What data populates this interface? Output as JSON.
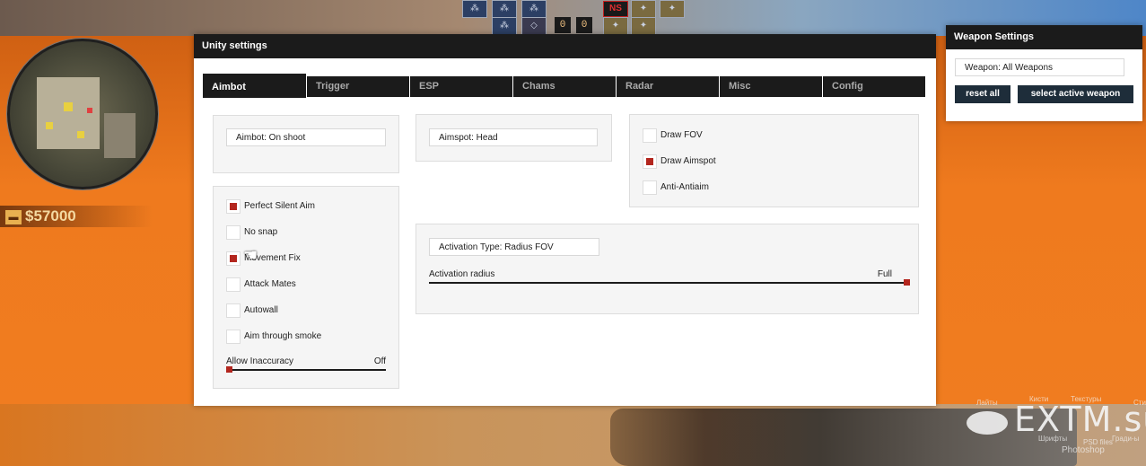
{
  "hud": {
    "money": "$57000",
    "scores": [
      "0",
      "0"
    ],
    "team_badge": "NS"
  },
  "unity": {
    "title": "Unity settings",
    "tabs": [
      "Aimbot",
      "Trigger",
      "ESP",
      "Chams",
      "Radar",
      "Misc",
      "Config"
    ],
    "active_tab": "Aimbot",
    "aimbot_mode": "Aimbot: On shoot",
    "aimspot": "Aimspot: Head",
    "left_checks": [
      {
        "label": "Perfect Silent Aim",
        "checked": true
      },
      {
        "label": "No snap",
        "checked": false
      },
      {
        "label": "Movement Fix",
        "checked": true
      },
      {
        "label": "Attack Mates",
        "checked": false
      },
      {
        "label": "Autowall",
        "checked": false
      },
      {
        "label": "Aim through smoke",
        "checked": false
      }
    ],
    "allow_inaccuracy": {
      "label": "Allow Inaccuracy",
      "value": "Off",
      "level": 0
    },
    "right_checks": [
      {
        "label": "Draw FOV",
        "checked": false
      },
      {
        "label": "Draw Aimspot",
        "checked": true
      },
      {
        "label": "Anti-Antiaim",
        "checked": false
      }
    ],
    "activation_type": "Activation Type: Radius FOV",
    "activation_radius": {
      "label": "Activation radius",
      "value": "Full",
      "level": 1
    }
  },
  "weapon_settings": {
    "title": "Weapon Settings",
    "weapon": "Weapon: All Weapons",
    "reset_label": "reset all",
    "select_label": "select active weapon"
  },
  "watermark": {
    "logo": "EXTM.su",
    "tags": [
      "Лайты",
      "Кисти",
      "Текстуры",
      "Стили",
      "Шрифты",
      "PSD files",
      "Гради-ы",
      "Photoshop"
    ]
  },
  "colors": {
    "accent": "#b3261e",
    "header": "#1b1b1b",
    "button": "#1e2d3a"
  }
}
